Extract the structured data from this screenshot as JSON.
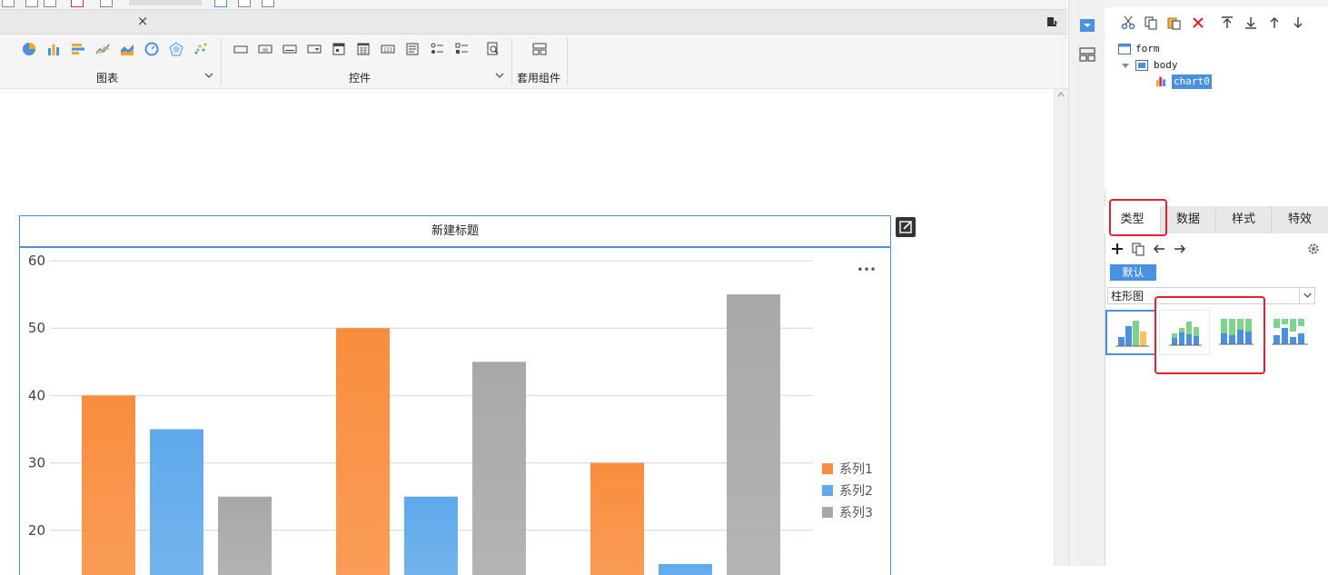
{
  "colors": {
    "accent": "#4a90e2",
    "series1": "#f98d3d",
    "series2": "#5ea9eb",
    "series3": "#a8a8a8",
    "highlight": "#e8202a"
  },
  "toolbar": {
    "chart_group_label": "图表",
    "control_group_label": "控件",
    "template_group_label": "套用组件",
    "chart_icons": [
      "pie-chart-icon",
      "bar-chart-icon",
      "horizontal-bar-icon",
      "line-chart-icon",
      "area-chart-icon",
      "gauge-icon",
      "radar-icon",
      "scatter-icon"
    ],
    "control_icons": [
      "label-icon",
      "textbox-icon",
      "button-icon",
      "dropdown-icon",
      "date-icon",
      "calendar-icon",
      "number-icon",
      "textarea-icon",
      "radio-group-icon",
      "checkbox-group-icon",
      "search-icon"
    ]
  },
  "tab": {
    "close_glyph": "×"
  },
  "chart": {
    "title": "新建标题",
    "more_glyph": "•••"
  },
  "chart_data": {
    "type": "bar",
    "title": "新建标题",
    "categories": [
      "",
      "",
      ""
    ],
    "series": [
      {
        "name": "系列1",
        "values": [
          40,
          50,
          30
        ]
      },
      {
        "name": "系列2",
        "values": [
          35,
          25,
          15
        ]
      },
      {
        "name": "系列3",
        "values": [
          25,
          45,
          55
        ]
      }
    ],
    "y_ticks": [
      60,
      50,
      40,
      30,
      20
    ],
    "ylim": [
      20,
      60
    ],
    "grid": true,
    "legend_position": "right"
  },
  "tree": {
    "form": "form",
    "body": "body",
    "chart": "chart0"
  },
  "right_tabs": [
    "类型",
    "数据",
    "样式",
    "特效"
  ],
  "default_badge": "默认",
  "chart_type_select": "柱形图",
  "chart_type_cards": [
    "clustered-bar-card",
    "stacked-bar-card",
    "percent-stacked-bar-card",
    "waterfall-bar-card"
  ]
}
